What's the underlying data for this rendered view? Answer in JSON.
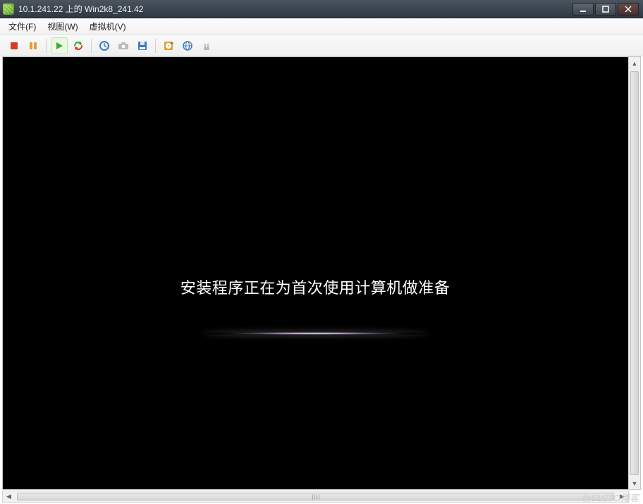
{
  "window": {
    "title": "10.1.241.22 上的 Win2k8_241.42"
  },
  "menu": {
    "file": "文件(F)",
    "view": "视图(W)",
    "vm": "虚拟机(V)"
  },
  "toolbar": {
    "icons": {
      "stop": "stop-icon",
      "pause": "pause-icon",
      "play": "play-icon",
      "refresh": "refresh-icon",
      "snapshot": "snapshot-icon",
      "camera": "camera-icon",
      "floppy": "floppy-icon",
      "cdrom": "cdrom-icon",
      "network": "network-icon",
      "usb": "usb-icon"
    }
  },
  "guest": {
    "setup_message": "安装程序正在为首次使用计算机做准备"
  },
  "watermark": "@51CTO博客"
}
